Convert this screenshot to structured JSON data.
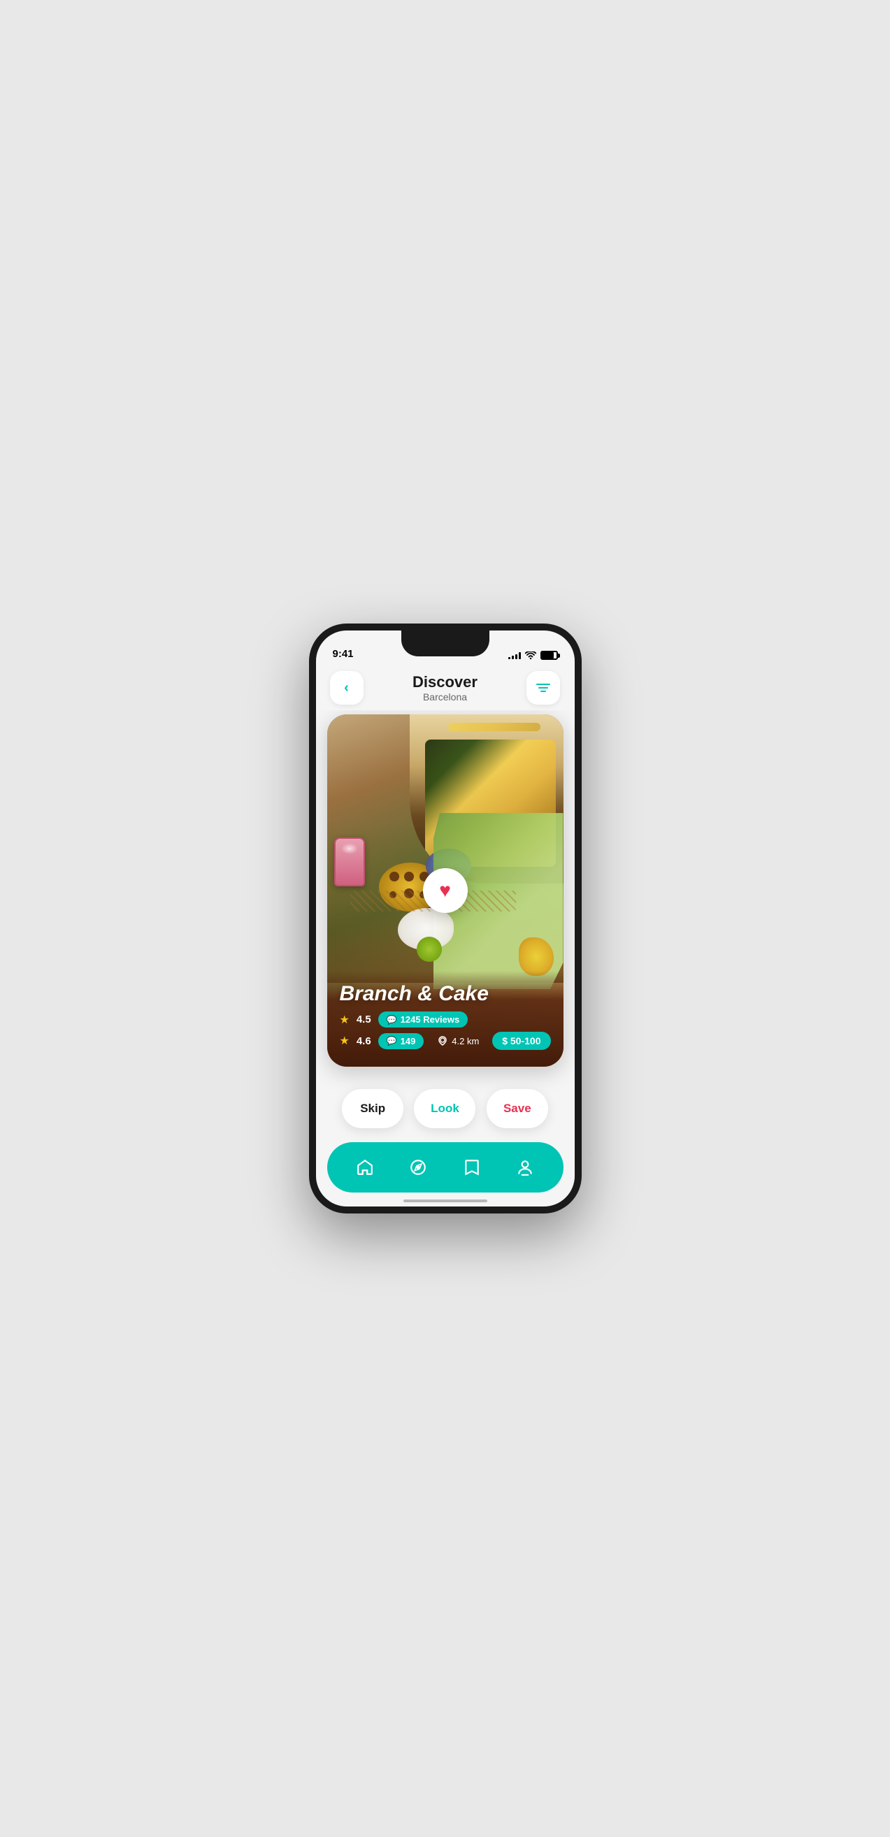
{
  "statusBar": {
    "time": "9:41",
    "signalBars": [
      3,
      5,
      7,
      9,
      11
    ],
    "wifiLabel": "wifi",
    "batteryLabel": "battery"
  },
  "header": {
    "backLabel": "<",
    "titleMain": "Discover",
    "titleSub": "Barcelona",
    "filterLabel": "filter"
  },
  "card": {
    "restaurantName": "Branch & Cake",
    "rating1": "4.5",
    "reviews1Count": "1245 Reviews",
    "rating2": "4.6",
    "reviews2Count": "149",
    "distance": "4.2 km",
    "price": "$ 50-100",
    "heartLabel": "favorite"
  },
  "actions": {
    "skipLabel": "Skip",
    "lookLabel": "Look",
    "saveLabel": "Save"
  },
  "bottomNav": {
    "homeLabel": "home",
    "discoverLabel": "discover",
    "savedLabel": "saved",
    "profileLabel": "profile"
  }
}
